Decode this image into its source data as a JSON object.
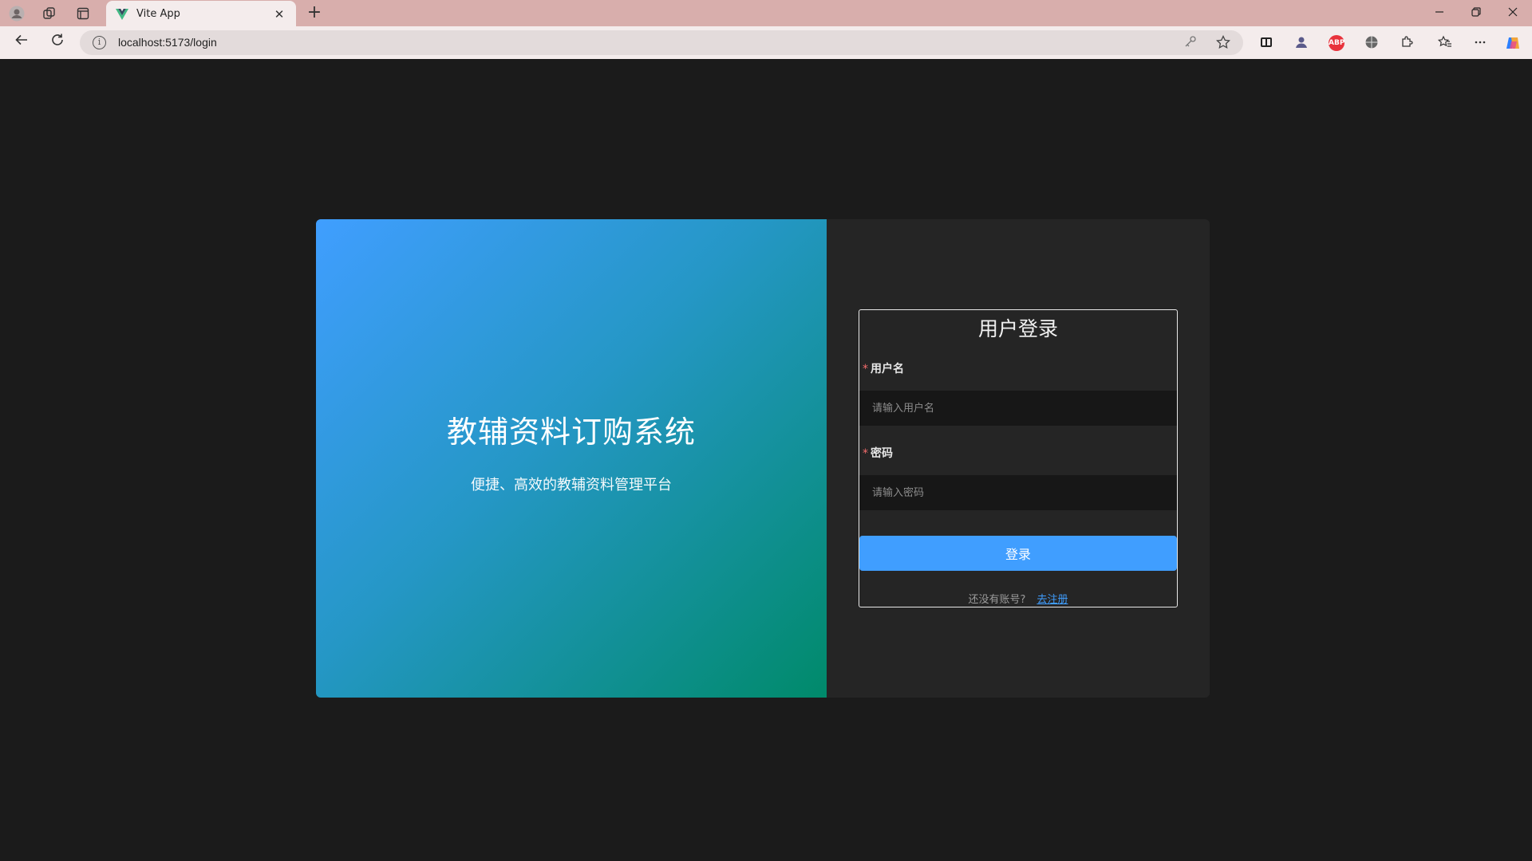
{
  "browser": {
    "tab_title": "Vite App",
    "url": "localhost:5173/login",
    "tab_close": "✕",
    "new_tab": "+",
    "ext_abp": "ABP"
  },
  "hero": {
    "title": "教辅资料订购系统",
    "subtitle": "便捷、高效的教辅资料管理平台"
  },
  "login": {
    "title": "用户登录",
    "username_label": "用户名",
    "username_placeholder": "请输入用户名",
    "password_label": "密码",
    "password_placeholder": "请输入密码",
    "required_mark": "*",
    "submit_label": "登录",
    "register_prompt": "还没有账号?",
    "register_link": "去注册"
  },
  "colors": {
    "primary": "#409eff",
    "gradient_start": "#409eff",
    "gradient_end": "#008a6a",
    "required": "#f56c6c",
    "titlebar": "#d8aeac"
  },
  "icons": [
    "profile-icon",
    "workspaces-icon",
    "tab-actions-icon",
    "vue-favicon",
    "back-icon",
    "refresh-icon",
    "info-icon",
    "key-icon",
    "star-icon",
    "extension-icons",
    "favorites-icon",
    "more-icon",
    "copilot-icon"
  ]
}
